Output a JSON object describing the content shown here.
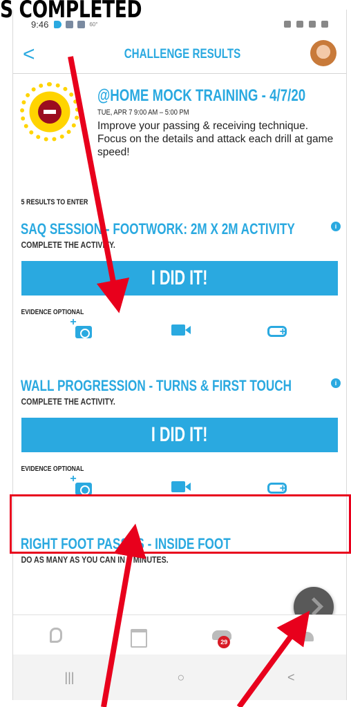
{
  "caption": "S COMPLETED",
  "status_bar": {
    "time": "9:46",
    "small_text": "60°"
  },
  "app_bar": {
    "back_label": "<",
    "title": "CHALLENGE RESULTS"
  },
  "challenge": {
    "title": "@HOME MOCK TRAINING - 4/7/20",
    "date": "TUE, APR 7 9:00 AM – 5:00 PM",
    "description": "Improve your passing & receiving technique. Focus on the details and attack each drill at game speed!"
  },
  "results_count": "5 RESULTS TO ENTER",
  "activities": [
    {
      "title": "SAQ SESSION - FOOTWORK: 2M X 2M ACTIVITY",
      "subtitle": "COMPLETE THE ACTIVITY.",
      "button": "I DID IT!",
      "evidence_label": "EVIDENCE OPTIONAL",
      "info": "i"
    },
    {
      "title": "WALL PROGRESSION - TURNS & FIRST TOUCH",
      "subtitle": "COMPLETE THE ACTIVITY.",
      "button": "I DID IT!",
      "evidence_label": "EVIDENCE OPTIONAL",
      "info": "i"
    },
    {
      "title": "RIGHT FOOT PASSES - INSIDE FOOT",
      "subtitle": "DO AS MANY AS YOU CAN IN 2 MINUTES."
    }
  ],
  "bottom_nav": {
    "inbox_badge": "29"
  },
  "system_nav": {
    "recent": "|||",
    "home": "○",
    "back": "<"
  },
  "colors": {
    "accent": "#2aa9e0",
    "annotation": "#e8001c",
    "fab": "#595959"
  }
}
